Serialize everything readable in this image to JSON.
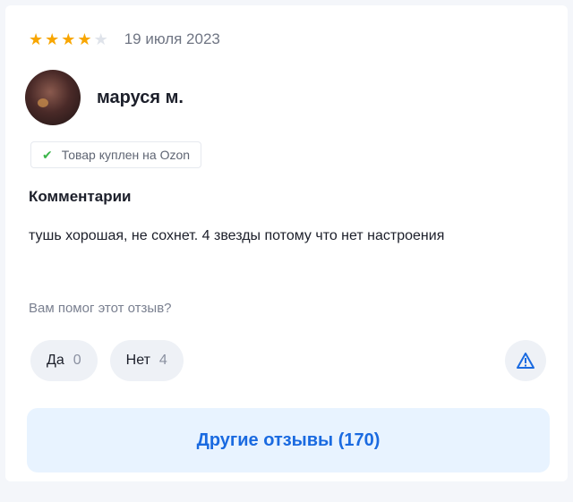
{
  "review": {
    "rating": 4,
    "max_rating": 5,
    "date": "19 июля 2023",
    "author": "маруся м.",
    "purchased_badge": "Товар куплен на Ozon",
    "comment_title": "Комментарии",
    "comment_text": "тушь хорошая, не сохнет. 4 звезды потому что нет настроения"
  },
  "helpful": {
    "question": "Вам помог этот отзыв?",
    "yes_label": "Да",
    "yes_count": "0",
    "no_label": "Нет",
    "no_count": "4"
  },
  "icons": {
    "star": "star-icon",
    "check": "check-icon",
    "report": "warning-icon"
  },
  "more_reviews_label": "Другие отзывы (170)",
  "colors": {
    "star_active": "#f8a600",
    "star_inactive": "#dfe3ea",
    "accent": "#1a6ae0",
    "check": "#3bb54a"
  }
}
